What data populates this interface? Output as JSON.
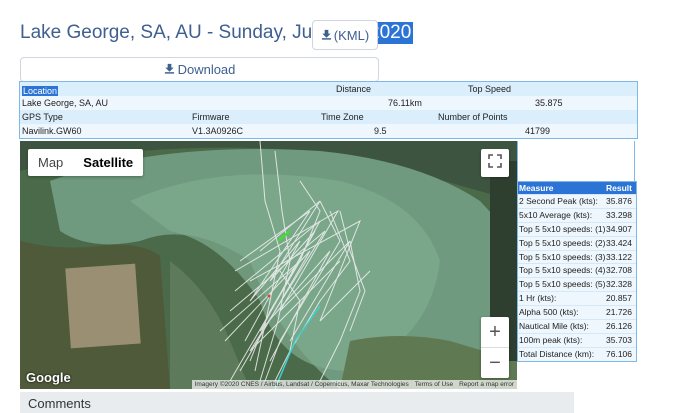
{
  "header": {
    "title_prefix": "Lake George, SA, AU - Sunday, June 14,",
    "title_year": "2020",
    "kml_label": "(KML)",
    "download_label": "Download"
  },
  "info": {
    "location_header": "Location",
    "location_value": "Lake George, SA, AU",
    "distance_header": "Distance",
    "distance_value": "76.11km",
    "top_speed_header": "Top Speed",
    "top_speed_value": "35.875",
    "gps_type_header": "GPS Type",
    "gps_type_value": "Navilink.GW60",
    "firmware_header": "Firmware",
    "firmware_value": "V1.3A0926C",
    "time_zone_header": "Time Zone",
    "time_zone_value": "9.5",
    "points_header": "Number of Points",
    "points_value": "41799"
  },
  "map": {
    "map_button": "Map",
    "satellite_button": "Satellite",
    "active_view": "Satellite",
    "zoom_in": "+",
    "zoom_out": "−",
    "google_logo": "Google",
    "attribution": "Imagery ©2020 CNES / Airbus, Landsat / Copernicus, Maxar Technologies",
    "terms": "Terms of Use",
    "report": "Report a map error"
  },
  "results": {
    "headers": [
      "Measure",
      "Result"
    ],
    "rows": [
      {
        "measure": "2 Second Peak (kts):",
        "result": "35.876"
      },
      {
        "measure": "5x10 Average (kts):",
        "result": "33.298"
      },
      {
        "measure": "Top 5 5x10 speeds: (1)",
        "result": "34.907"
      },
      {
        "measure": "Top 5 5x10 speeds: (2)",
        "result": "33.424"
      },
      {
        "measure": "Top 5 5x10 speeds: (3)",
        "result": "33.122"
      },
      {
        "measure": "Top 5 5x10 speeds: (4)",
        "result": "32.708"
      },
      {
        "measure": "Top 5 5x10 speeds: (5)",
        "result": "32.328"
      },
      {
        "measure": "1 Hr (kts):",
        "result": "20.857"
      },
      {
        "measure": "Alpha 500 (kts):",
        "result": "21.726"
      },
      {
        "measure": "Nautical Mile (kts):",
        "result": "26.126"
      },
      {
        "measure": "100m peak (kts):",
        "result": "35.703"
      },
      {
        "measure": "Total Distance (km):",
        "result": "76.106"
      }
    ]
  },
  "comments": {
    "title": "Comments"
  },
  "colors": {
    "accent": "#2b74d6",
    "title_text": "#3e5f8f",
    "table_bg": "#dbeefb",
    "track": "#f2f2f2",
    "track_highlight": "#44dd33",
    "track_cyan": "#3fd0d0"
  }
}
